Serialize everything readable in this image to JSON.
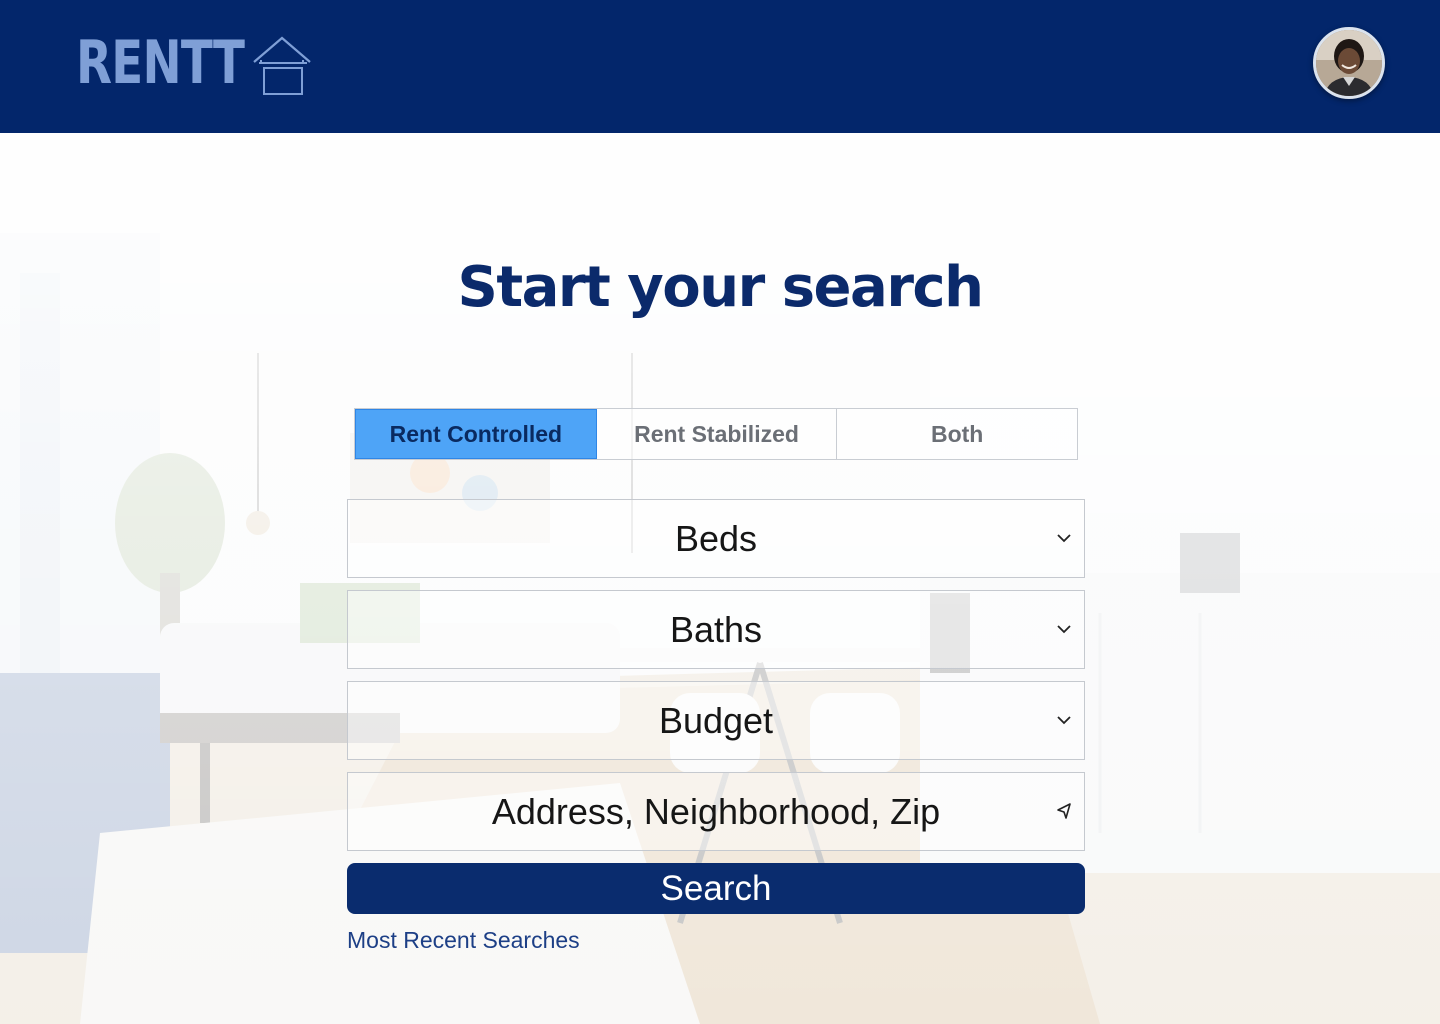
{
  "header": {
    "logo_text": "RENTT",
    "logo_icon": "house-outline-icon",
    "avatar_icon": "user-avatar",
    "colors": {
      "bar": "#03266b",
      "logo": "#7f9fd6"
    }
  },
  "main": {
    "title": "Start your search",
    "rent_type": {
      "options": [
        "Rent Controlled",
        "Rent Stabilized",
        "Both"
      ],
      "selected": "Rent Controlled",
      "colors": {
        "active_bg": "#4ea4f7"
      }
    },
    "filters": {
      "beds": {
        "label": "Beds",
        "icon": "chevron-down-icon"
      },
      "baths": {
        "label": "Baths",
        "icon": "chevron-down-icon"
      },
      "budget": {
        "label": "Budget",
        "icon": "chevron-down-icon"
      },
      "location": {
        "placeholder": "Address, Neighborhood, Zip",
        "icon": "location-arrow-icon"
      }
    },
    "search_label": "Search",
    "recent_label": "Most Recent Searches",
    "colors": {
      "title": "#0b2a6b",
      "button": "#0a2c6e",
      "link": "#1d3f86"
    }
  }
}
